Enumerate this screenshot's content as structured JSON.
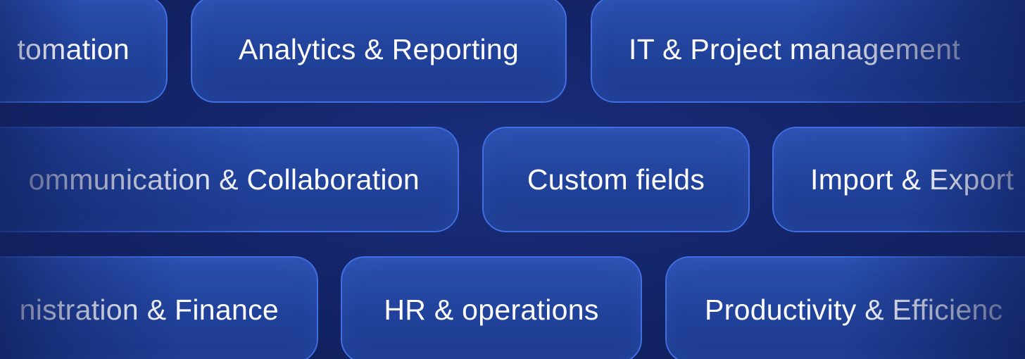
{
  "colors": {
    "background": "#14256a",
    "chip_fill": "#21429a",
    "chip_border": "#3f6fe0",
    "text": "#ffffff"
  },
  "rows": [
    {
      "chips": [
        {
          "label": "tomation"
        },
        {
          "label": "Analytics & Reporting"
        },
        {
          "label": "IT & Project management"
        }
      ]
    },
    {
      "chips": [
        {
          "label": "ommunication & Collaboration"
        },
        {
          "label": "Custom fields"
        },
        {
          "label": "Import & Export"
        }
      ]
    },
    {
      "chips": [
        {
          "label": "nistration & Finance"
        },
        {
          "label": "HR & operations"
        },
        {
          "label": "Productivity & Efficienc"
        }
      ]
    }
  ]
}
